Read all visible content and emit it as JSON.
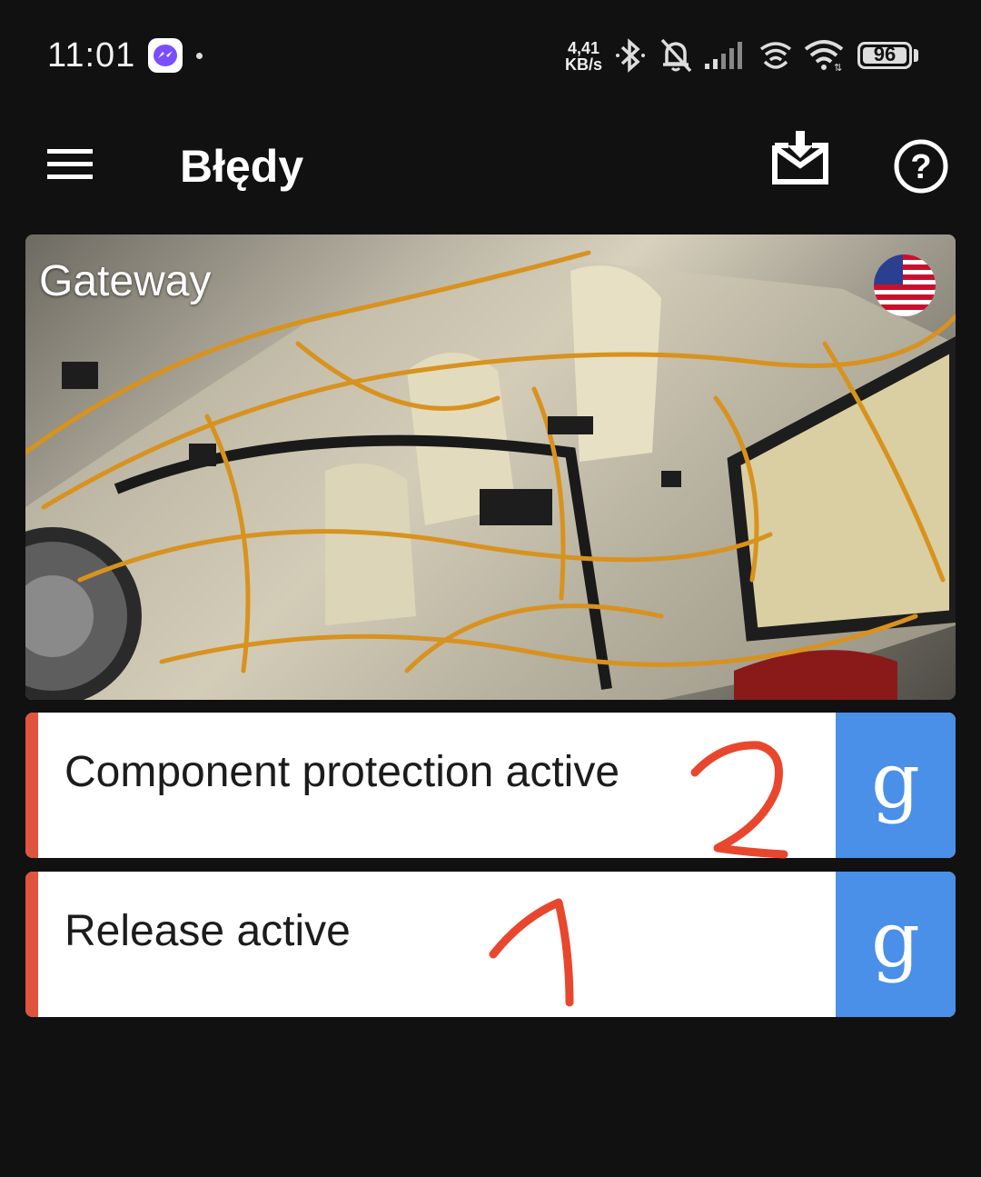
{
  "status_bar": {
    "time": "11:01",
    "net_speed_value": "4,41",
    "net_speed_unit": "KB/s",
    "battery": "96",
    "icons": [
      "messenger-icon",
      "bluetooth-icon",
      "bell-off-icon",
      "signal-icon",
      "hotspot-icon",
      "wifi-icon",
      "battery-icon"
    ]
  },
  "appbar": {
    "title": "Błędy",
    "icons": [
      "menu-icon",
      "download-inbox-icon",
      "help-icon"
    ]
  },
  "hero": {
    "label": "Gateway",
    "flag": "us-flag-icon"
  },
  "faults": [
    {
      "text": "Component protection active",
      "button_glyph": "g",
      "annotation": "2"
    },
    {
      "text": "Release active",
      "button_glyph": "g",
      "annotation": "1"
    }
  ],
  "colors": {
    "background": "#111111",
    "accent_red": "#e0533d",
    "google_button": "#4a8fe8",
    "annotation_red": "#e8472e"
  }
}
